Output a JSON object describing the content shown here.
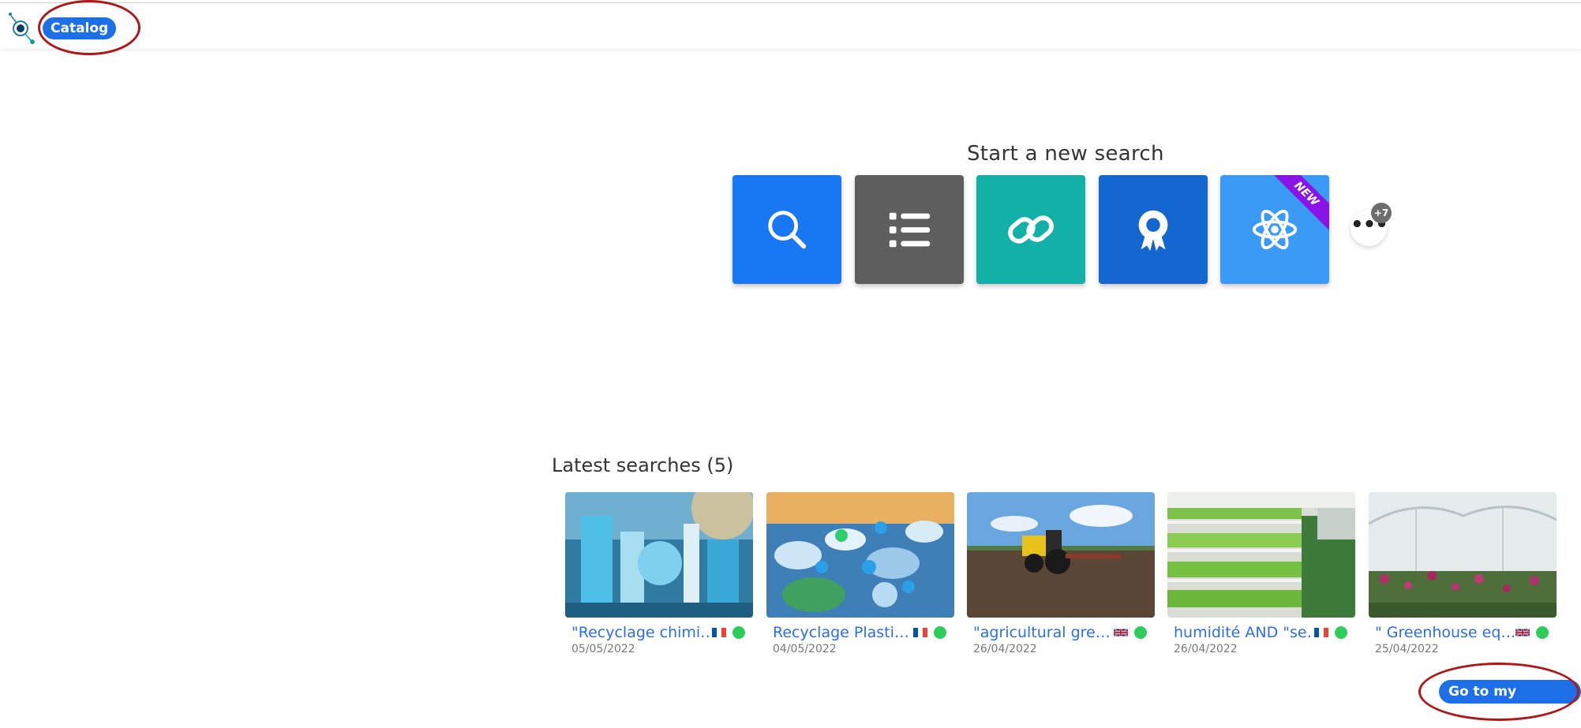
{
  "header": {
    "catalog_label": "Catalog"
  },
  "new_search": {
    "title": "Start a new search",
    "tiles": [
      {
        "icon": "search-icon",
        "color": "#1877f2"
      },
      {
        "icon": "list-icon",
        "color": "#5e5e5e"
      },
      {
        "icon": "link-icon",
        "color": "#13b0a8"
      },
      {
        "icon": "award-icon",
        "color": "#1467d0"
      },
      {
        "icon": "atom-icon",
        "color": "#3a9af5",
        "badge": "NEW"
      }
    ],
    "more_count": "+7"
  },
  "latest": {
    "title": "Latest searches (5)",
    "items": [
      {
        "title": "\"Recyclage chimi…",
        "flag": "fr",
        "date": "05/05/2022"
      },
      {
        "title": "Recyclage Plasti…",
        "flag": "fr",
        "date": "04/05/2022"
      },
      {
        "title": "\"agricultural gre…",
        "flag": "gb",
        "date": "26/04/2022"
      },
      {
        "title": "humidité AND \"se…",
        "flag": "fr",
        "date": "26/04/2022"
      },
      {
        "title": "\" Greenhouse eq…",
        "flag": "gb",
        "date": "25/04/2022"
      }
    ],
    "goto_label": "Go to my catalog"
  },
  "colors": {
    "accent": "#1d6fe8",
    "status_green": "#2ecc5a",
    "annotation_ring": "#b01818"
  }
}
